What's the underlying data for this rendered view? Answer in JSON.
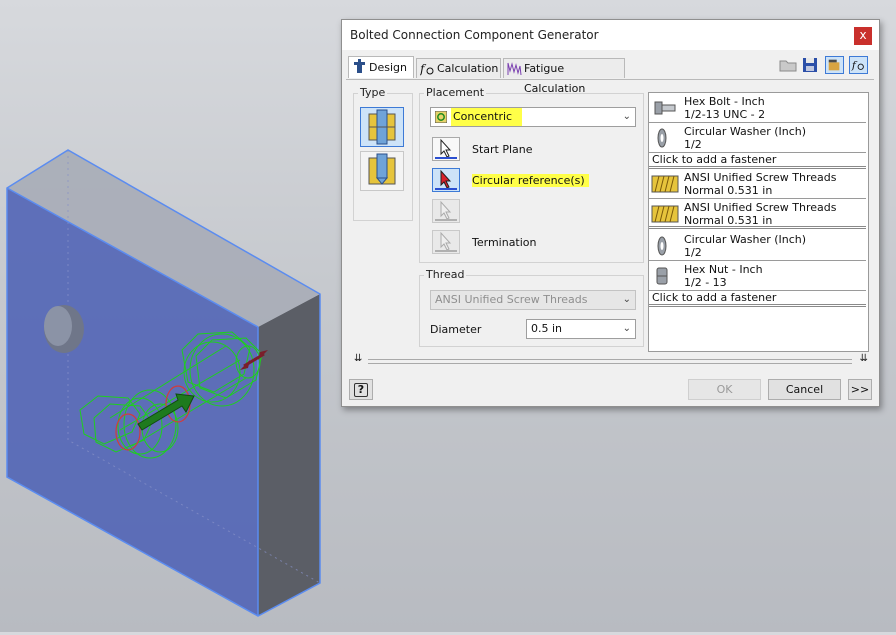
{
  "dialog": {
    "title": "Bolted Connection Component Generator",
    "close_glyph": "x"
  },
  "tabs": [
    {
      "label": "Design",
      "icon": "bolt-design-icon"
    },
    {
      "label": "Calculation",
      "icon": "formula-icon"
    },
    {
      "label": "Fatigue Calculation",
      "icon": "fatigue-graph-icon"
    }
  ],
  "toolbar_icons": [
    "open-folder-icon",
    "save-icon",
    "settings-icon",
    "calculation-toggle-icon"
  ],
  "type_group": {
    "label": "Type",
    "options": [
      {
        "name": "through-bolt-type",
        "selected": true
      },
      {
        "name": "blind-hole-type",
        "selected": false
      }
    ]
  },
  "placement": {
    "label": "Placement",
    "mode": "Concentric",
    "start_plane_label": "Start Plane",
    "circular_reference_label": "Circular reference(s)",
    "termination_label": "Termination"
  },
  "thread": {
    "label": "Thread",
    "type": "ANSI Unified Screw Threads",
    "diameter_label": "Diameter",
    "diameter_value": "0.5 in"
  },
  "fasteners": [
    {
      "kind": "row",
      "icon": "hex-bolt-icon",
      "line1": "Hex Bolt - Inch",
      "line2": "1/2-13 UNC - 2"
    },
    {
      "kind": "row",
      "icon": "circular-washer-icon",
      "line1": "Circular Washer (Inch)",
      "line2": "1/2"
    },
    {
      "kind": "add",
      "label": "Click to add a fastener"
    },
    {
      "kind": "row",
      "icon": "threaded-hole-icon",
      "line1": "ANSI Unified Screw Threads",
      "line2": "Normal 0.531 in"
    },
    {
      "kind": "row",
      "icon": "threaded-hole-icon",
      "line1": "ANSI Unified Screw Threads",
      "line2": "Normal 0.531 in"
    },
    {
      "kind": "row",
      "icon": "circular-washer-icon",
      "line1": "Circular Washer (Inch)",
      "line2": "1/2"
    },
    {
      "kind": "row",
      "icon": "hex-nut-icon",
      "line1": "Hex Nut - Inch",
      "line2": "1/2 - 13"
    },
    {
      "kind": "add",
      "label": "Click to add a fastener"
    }
  ],
  "expander_glyph": "¥",
  "footer": {
    "help_glyph": "?",
    "ok_label": "OK",
    "cancel_label": "Cancel",
    "more_label": ">>"
  },
  "colors": {
    "highlight": "#ffff48",
    "selection_blue": "#3d7ad6",
    "close_red": "#c9302c",
    "plate_blue": "#4f62b5"
  }
}
